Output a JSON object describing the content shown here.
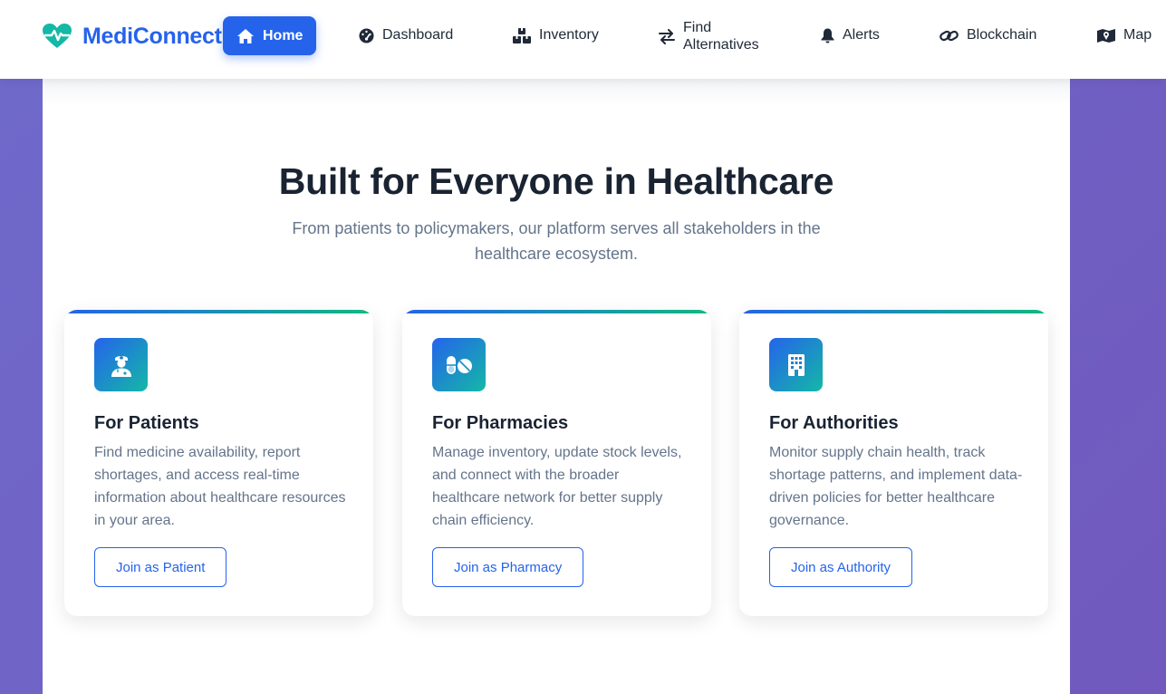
{
  "brand": {
    "name": "MediConnect",
    "icon": "heartbeat-icon",
    "color": "#2563eb"
  },
  "nav": [
    {
      "label": "Home",
      "icon": "home-icon",
      "active": true
    },
    {
      "label": "Dashboard",
      "icon": "dashboard-icon"
    },
    {
      "label": "Inventory",
      "icon": "boxes-icon"
    },
    {
      "label_line1": "Find",
      "label_line2": "Alternatives",
      "icon": "exchange-icon"
    },
    {
      "label": "Alerts",
      "icon": "bell-icon"
    },
    {
      "label": "Blockchain",
      "icon": "link-icon"
    },
    {
      "label": "Map",
      "icon": "map-icon"
    }
  ],
  "section": {
    "title": "Built for Everyone in Healthcare",
    "subtitle": "From patients to policymakers, our platform serves all stakeholders in the healthcare ecosystem."
  },
  "cards": [
    {
      "icon": "doctor-icon",
      "title": "For Patients",
      "description": "Find medicine availability, report shortages, and access real-time information about healthcare resources in your area.",
      "button": "Join as Patient"
    },
    {
      "icon": "pills-icon",
      "title": "For Pharmacies",
      "description": "Manage inventory, update stock levels, and connect with the broader healthcare network for better supply chain efficiency.",
      "button": "Join as Pharmacy"
    },
    {
      "icon": "hospital-icon",
      "title": "For Authorities",
      "description": "Monitor supply chain health, track shortage patterns, and implement data-driven policies for better healthcare governance.",
      "button": "Join as Authority"
    }
  ],
  "colors": {
    "accent": "#2563eb",
    "accent_secondary": "#10b981",
    "background": "#6f6acb",
    "text_dark": "#1a2332",
    "text_muted": "#64748b"
  }
}
